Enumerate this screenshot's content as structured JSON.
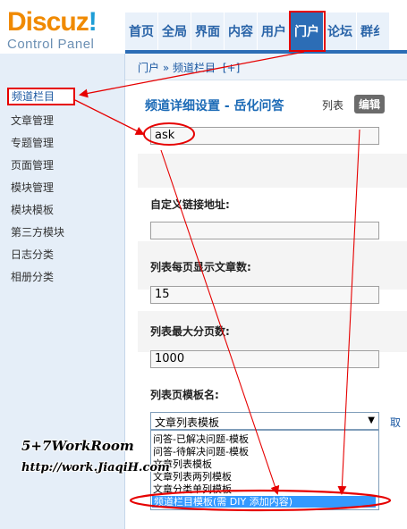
{
  "logo": {
    "word": "Discuz",
    "bang": "!",
    "subtitle": "Control Panel"
  },
  "topnav": {
    "tabs": [
      {
        "label": "首页",
        "active": false
      },
      {
        "label": "全局",
        "active": false
      },
      {
        "label": "界面",
        "active": false
      },
      {
        "label": "内容",
        "active": false
      },
      {
        "label": "用户",
        "active": false
      },
      {
        "label": "门户",
        "active": true
      },
      {
        "label": "论坛",
        "active": false
      },
      {
        "label": "群纟",
        "active": false
      }
    ]
  },
  "breadcrumb": {
    "root": "门户",
    "separator": "»",
    "current": "频道栏目",
    "add": "[+]"
  },
  "sidebar": {
    "items": [
      {
        "label": "频道栏目",
        "active": true
      },
      {
        "label": "文章管理",
        "active": false
      },
      {
        "label": "专题管理",
        "active": false
      },
      {
        "label": "页面管理",
        "active": false
      },
      {
        "label": "模块管理",
        "active": false
      },
      {
        "label": "模块模板",
        "active": false
      },
      {
        "label": "第三方模块",
        "active": false
      },
      {
        "label": "日志分类",
        "active": false
      },
      {
        "label": "相册分类",
        "active": false
      }
    ]
  },
  "main": {
    "title": "频道详细设置 - 岳化问答",
    "view_list": "列表",
    "view_edit": "编辑",
    "name_value": "ask",
    "custom_link_label": "自定义链接地址:",
    "custom_link_value": "",
    "per_page_label": "列表每页显示文章数:",
    "per_page_value": "15",
    "max_pages_label": "列表最大分页数:",
    "max_pages_value": "1000",
    "template_label": "列表页模板名:",
    "template_selected": "文章列表模板",
    "template_side": "取",
    "template_options": [
      "问答-已解决问题-模板",
      "问答-待解决问题-模板",
      "文章列表模板",
      "文章列表两列模板",
      "文章分类单列模板",
      "频道栏目模板(需 DIY 添加内容)"
    ],
    "selected_option_index": 5
  },
  "watermark": {
    "line1": "5+7WorkRoom",
    "line2": "http://work.JiaqiH.com"
  },
  "colors": {
    "annotation": "#e60000",
    "accent": "#2c6db6",
    "selection": "#3399ff"
  }
}
